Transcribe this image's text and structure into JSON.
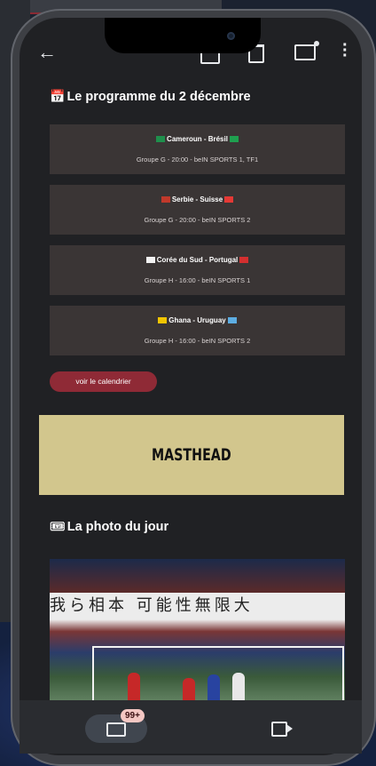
{
  "colors": {
    "background": "#202124",
    "card": "#3a3535",
    "cta": "#8f2a36",
    "masthead": "#d2c68d"
  },
  "toolbar": {
    "icons": [
      "arrow-left-icon",
      "archive-icon",
      "delete-icon",
      "mark-unread-icon",
      "more-vertical-icon"
    ]
  },
  "programme": {
    "title": "Le programme du 2 décembre",
    "icon": "calendar-emoji",
    "matches": [
      {
        "teams": "Cameroun - Brésil",
        "info": "Groupe G - 20:00 - beIN SPORTS 1, TF1",
        "flag_left": "#1f8f4c",
        "flag_right": "#1f9f4f"
      },
      {
        "teams": "Serbie - Suisse",
        "info": "Groupe G - 20:00 - beIN SPORTS 2",
        "flag_left": "#c0392b",
        "flag_right": "#e53935"
      },
      {
        "teams": "Corée du Sud - Portugal",
        "info": "Groupe H - 16:00 - beIN SPORTS 1",
        "flag_left": "#f2f2f2",
        "flag_right": "#d32f2f"
      },
      {
        "teams": "Ghana - Uruguay",
        "info": "Groupe H - 16:00 - beIN SPORTS 2",
        "flag_left": "#f2c500",
        "flag_right": "#5dade2"
      }
    ],
    "cta": "voir le calendrier"
  },
  "masthead": {
    "label": "MASTHEAD"
  },
  "photo_section": {
    "title": "La photo du jour",
    "icon": "ticket-emoji",
    "banner_text": "我ら相本 可能性無限大"
  },
  "bottom_nav": {
    "mail_badge": "99+",
    "mail_icon": "mail-icon",
    "meet_icon": "video-icon"
  }
}
